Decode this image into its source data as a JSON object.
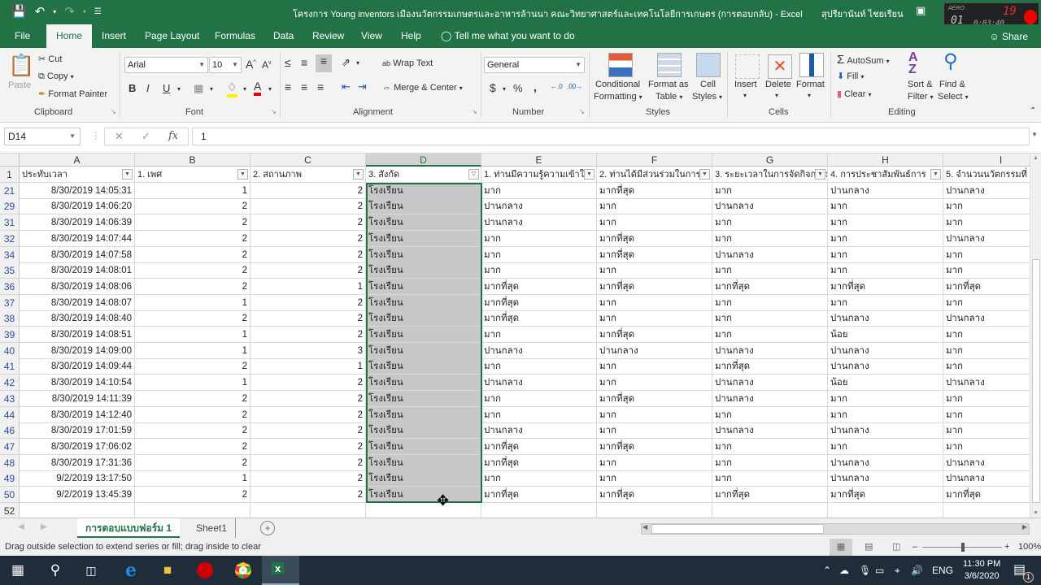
{
  "titlebar": {
    "title": "โครงการ  Young inventors เมืองนวัตกรรมเกษตรและอาหารล้านนา คณะวิทยาศาสตร์และเทคโนโลยีการเกษตร (การตอบกลับ)  -  Excel",
    "user": "สุปรียานันท์  ไชยเรียน",
    "recorder": {
      "brand": "AERO",
      "counter": "01",
      "fps": "19",
      "elapsed": "0:03:40"
    }
  },
  "tabs": [
    "File",
    "Home",
    "Insert",
    "Page Layout",
    "Formulas",
    "Data",
    "Review",
    "View",
    "Help"
  ],
  "active_tab": "Home",
  "tell_me": "Tell me what you want to do",
  "share": "Share",
  "ribbon": {
    "clipboard": {
      "label": "Clipboard",
      "paste": "Paste",
      "cut": "Cut",
      "copy": "Copy",
      "format_painter": "Format Painter"
    },
    "font": {
      "label": "Font",
      "font_name": "Arial",
      "font_size": "10",
      "bold": "B",
      "italic": "I",
      "underline": "U"
    },
    "alignment": {
      "label": "Alignment",
      "wrap_text": "Wrap Text",
      "merge_center": "Merge & Center"
    },
    "number": {
      "label": "Number",
      "format": "General",
      "currency": "$",
      "percent": "%",
      "comma": ","
    },
    "styles": {
      "label": "Styles",
      "conditional1": "Conditional",
      "conditional2": "Formatting",
      "format_table1": "Format as",
      "format_table2": "Table",
      "cell_styles1": "Cell",
      "cell_styles2": "Styles"
    },
    "cells": {
      "label": "Cells",
      "insert": "Insert",
      "delete": "Delete",
      "format": "Format"
    },
    "editing": {
      "label": "Editing",
      "autosum": "AutoSum",
      "fill": "Fill",
      "clear": "Clear",
      "sort1": "Sort &",
      "sort2": "Filter",
      "find1": "Find &",
      "find2": "Select"
    }
  },
  "formula_bar": {
    "name_box": "D14",
    "value": "1"
  },
  "columns": [
    "A",
    "B",
    "C",
    "D",
    "E",
    "F",
    "G",
    "H",
    "I"
  ],
  "selected_column": "D",
  "header_row": {
    "row": "1",
    "cells": [
      "ประทับเวลา",
      "1. เพศ",
      "2. สถานภาพ",
      "3. สังกัด",
      "1. ท่านมีความรู้ความเข้าใจ",
      "2. ท่านได้มีส่วนร่วมในการ",
      "3. ระยะเวลาในการจัดกิจกรรม",
      "4. การประชาสัมพันธ์การ",
      "5. จำนวนนวัตกรรมที่"
    ]
  },
  "rows": [
    {
      "row": "21",
      "cells": [
        "8/30/2019 14:05:31",
        "1",
        "2",
        "โรงเรียน",
        "มาก",
        "มากที่สุด",
        "มาก",
        "ปานกลาง",
        "ปานกลาง"
      ]
    },
    {
      "row": "29",
      "cells": [
        "8/30/2019 14:06:20",
        "2",
        "2",
        "โรงเรียน",
        "ปานกลาง",
        "มาก",
        "ปานกลาง",
        "มาก",
        "มาก"
      ]
    },
    {
      "row": "31",
      "cells": [
        "8/30/2019 14:06:39",
        "2",
        "2",
        "โรงเรียน",
        "ปานกลาง",
        "มาก",
        "มาก",
        "มาก",
        "มาก"
      ]
    },
    {
      "row": "32",
      "cells": [
        "8/30/2019 14:07:44",
        "2",
        "2",
        "โรงเรียน",
        "มาก",
        "มากที่สุด",
        "มาก",
        "มาก",
        "ปานกลาง"
      ]
    },
    {
      "row": "34",
      "cells": [
        "8/30/2019 14:07:58",
        "2",
        "2",
        "โรงเรียน",
        "มาก",
        "มากที่สุด",
        "ปานกลาง",
        "มาก",
        "มาก"
      ]
    },
    {
      "row": "35",
      "cells": [
        "8/30/2019 14:08:01",
        "2",
        "2",
        "โรงเรียน",
        "มาก",
        "มาก",
        "มาก",
        "มาก",
        "มาก"
      ]
    },
    {
      "row": "36",
      "cells": [
        "8/30/2019 14:08:06",
        "2",
        "1",
        "โรงเรียน",
        "มากที่สุด",
        "มากที่สุด",
        "มากที่สุด",
        "มากที่สุด",
        "มากที่สุด"
      ]
    },
    {
      "row": "37",
      "cells": [
        "8/30/2019 14:08:07",
        "1",
        "2",
        "โรงเรียน",
        "มากที่สุด",
        "มาก",
        "มาก",
        "มาก",
        "มาก"
      ]
    },
    {
      "row": "38",
      "cells": [
        "8/30/2019 14:08:40",
        "2",
        "2",
        "โรงเรียน",
        "มากที่สุด",
        "มาก",
        "มาก",
        "ปานกลาง",
        "ปานกลาง"
      ]
    },
    {
      "row": "39",
      "cells": [
        "8/30/2019 14:08:51",
        "1",
        "2",
        "โรงเรียน",
        "มาก",
        "มากที่สุด",
        "มาก",
        "น้อย",
        "มาก"
      ]
    },
    {
      "row": "40",
      "cells": [
        "8/30/2019 14:09:00",
        "1",
        "3",
        "โรงเรียน",
        "ปานกลาง",
        "ปานกลาง",
        "ปานกลาง",
        "ปานกลาง",
        "มาก"
      ]
    },
    {
      "row": "41",
      "cells": [
        "8/30/2019 14:09:44",
        "2",
        "1",
        "โรงเรียน",
        "มาก",
        "มาก",
        "มากที่สุด",
        "ปานกลาง",
        "มาก"
      ]
    },
    {
      "row": "42",
      "cells": [
        "8/30/2019 14:10:54",
        "1",
        "2",
        "โรงเรียน",
        "ปานกลาง",
        "มาก",
        "ปานกลาง",
        "น้อย",
        "ปานกลาง"
      ]
    },
    {
      "row": "43",
      "cells": [
        "8/30/2019 14:11:39",
        "2",
        "2",
        "โรงเรียน",
        "มาก",
        "มากที่สุด",
        "ปานกลาง",
        "มาก",
        "มาก"
      ]
    },
    {
      "row": "44",
      "cells": [
        "8/30/2019 14:12:40",
        "2",
        "2",
        "โรงเรียน",
        "มาก",
        "มาก",
        "มาก",
        "มาก",
        "มาก"
      ]
    },
    {
      "row": "46",
      "cells": [
        "8/30/2019 17:01:59",
        "2",
        "2",
        "โรงเรียน",
        "ปานกลาง",
        "มาก",
        "ปานกลาง",
        "ปานกลาง",
        "มาก"
      ]
    },
    {
      "row": "47",
      "cells": [
        "8/30/2019 17:06:02",
        "2",
        "2",
        "โรงเรียน",
        "มากที่สุด",
        "มากที่สุด",
        "มาก",
        "มาก",
        "มาก"
      ]
    },
    {
      "row": "48",
      "cells": [
        "8/30/2019 17:31:36",
        "2",
        "2",
        "โรงเรียน",
        "มากที่สุด",
        "มาก",
        "มาก",
        "ปานกลาง",
        "ปานกลาง"
      ]
    },
    {
      "row": "49",
      "cells": [
        "9/2/2019 13:17:50",
        "1",
        "2",
        "โรงเรียน",
        "มาก",
        "มาก",
        "มาก",
        "ปานกลาง",
        "ปานกลาง"
      ]
    },
    {
      "row": "50",
      "cells": [
        "9/2/2019 13:45:39",
        "2",
        "2",
        "โรงเรียน",
        "มากที่สุด",
        "มากที่สุด",
        "มากที่สุด",
        "มากที่สุด",
        "มากที่สุด"
      ]
    }
  ],
  "empty_row": "52",
  "sheets": [
    "การตอบแบบฟอร์ม 1",
    "Sheet1"
  ],
  "active_sheet": "การตอบแบบฟอร์ม 1",
  "status_text": "Drag outside selection to extend series or fill; drag inside to clear",
  "zoom_level": "100%",
  "taskbar": {
    "language": "ENG",
    "time": "11:30 PM",
    "date": "3/6/2020",
    "notifications": "1"
  },
  "colors": {
    "excel_green": "#217346",
    "selection_fill": "#c8c8c8",
    "taskbar": "#1f2d3a"
  }
}
